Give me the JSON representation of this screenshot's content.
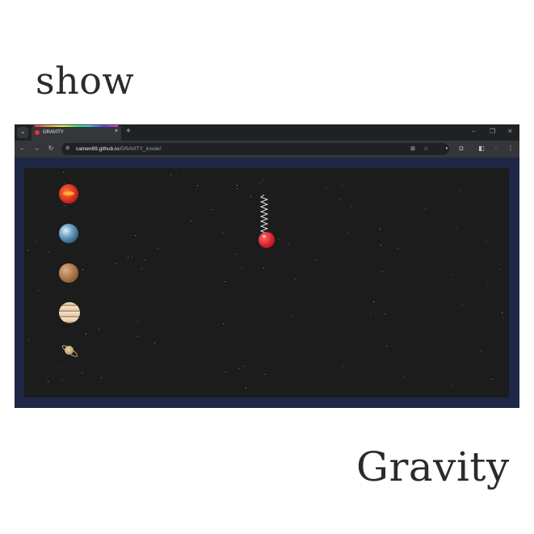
{
  "headings": {
    "top": "show",
    "bottom": "Gravity"
  },
  "browser": {
    "tab": {
      "title": "GRAVITY",
      "favicon": "apple-favicon-icon",
      "close_glyph": "×"
    },
    "new_tab_glyph": "+",
    "window_controls": {
      "minimize": "–",
      "restore": "❐",
      "close": "✕"
    },
    "toolbar": {
      "back": "←",
      "forward": "→",
      "reload": "↻",
      "site_info": "⚙"
    },
    "address_bar": {
      "host": "camen89.github.io",
      "path": "/GRAVITY_inside/"
    }
  },
  "page": {
    "planets": [
      "sun",
      "earth",
      "mars",
      "jupiter",
      "saturn"
    ],
    "objects": [
      "apple-on-spring"
    ],
    "colors": {
      "frame": "#1f2747",
      "space": "#1c1c1c"
    }
  }
}
